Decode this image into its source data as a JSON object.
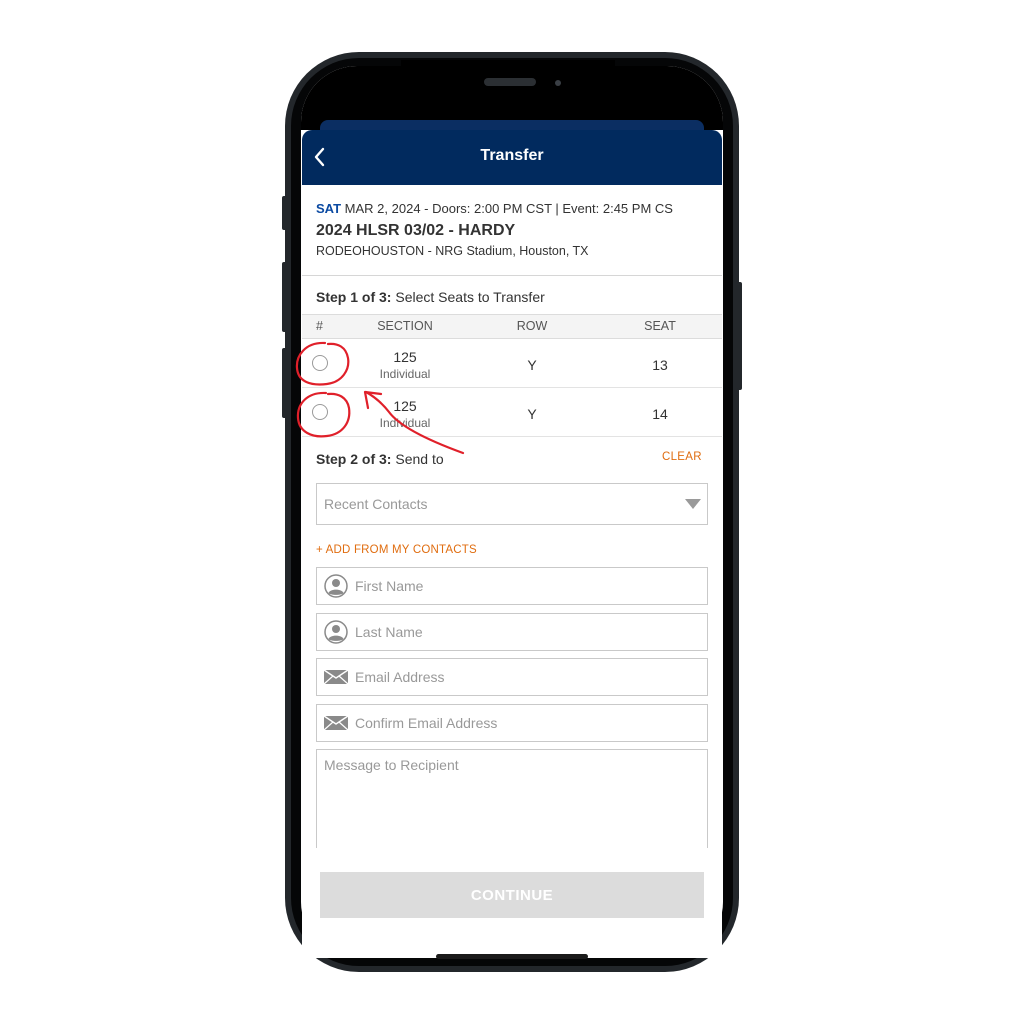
{
  "header": {
    "title": "Transfer",
    "back_icon": "chevron-left-icon"
  },
  "event": {
    "day": "SAT",
    "datetime": "MAR 2, 2024 - Doors: 2:00 PM CST | Event: 2:45 PM CS",
    "title": "2024 HLSR 03/02 - HARDY",
    "venue": "RODEOHOUSTON - NRG Stadium, Houston, TX"
  },
  "step1": {
    "prefix": "Step 1 of 3:",
    "text": "Select Seats to Transfer",
    "columns": [
      "#",
      "SECTION",
      "ROW",
      "SEAT"
    ],
    "rows": [
      {
        "section": "125",
        "type": "Individual",
        "row": "Y",
        "seat": "13",
        "selected": false
      },
      {
        "section": "125",
        "type": "Individual",
        "row": "Y",
        "seat": "14",
        "selected": false
      }
    ]
  },
  "step2": {
    "prefix": "Step 2 of 3:",
    "text": "Send to",
    "clear_label": "CLEAR",
    "recent_contacts_placeholder": "Recent Contacts",
    "add_contacts_label": "+ ADD FROM MY CONTACTS",
    "first_name_placeholder": "First Name",
    "last_name_placeholder": "Last Name",
    "email_placeholder": "Email Address",
    "confirm_email_placeholder": "Confirm Email Address",
    "message_placeholder": "Message to Recipient"
  },
  "footer": {
    "continue_label": "CONTINUE"
  },
  "colors": {
    "header_bg": "#012a5e",
    "accent_orange": "#e06d10",
    "day_blue": "#0b4aa2",
    "annotation_red": "#e0202a",
    "button_disabled": "#dcdcdc"
  }
}
